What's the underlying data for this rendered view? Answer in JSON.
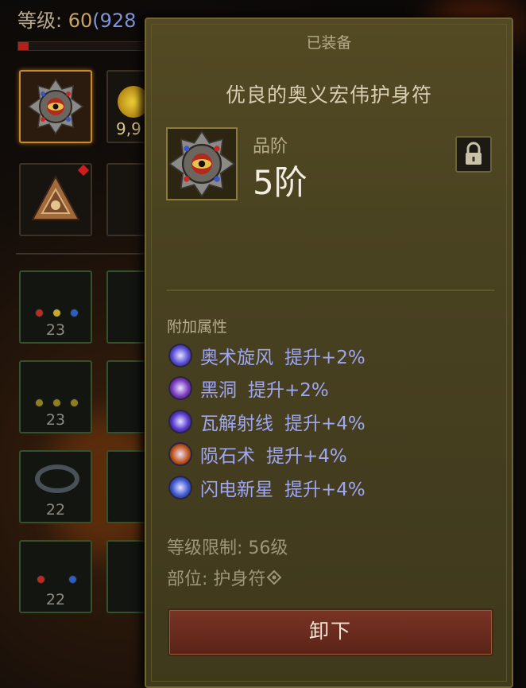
{
  "hud": {
    "level_prefix": "等级: ",
    "level": "60",
    "paragon": "(928",
    "xp_fraction": 0.08
  },
  "inventory": {
    "currency_amount": "9,9",
    "slot_counts": [
      "23",
      "23",
      "22",
      "22"
    ]
  },
  "tooltip": {
    "status": "已装备",
    "item_name": "优良的奥义宏伟护身符",
    "rank_label": "品阶",
    "rank_value": "5阶",
    "lock_icon": "padlock-icon",
    "attributes_title": "附加属性",
    "attributes": [
      {
        "name": "奥术旋风",
        "bonus": "提升+2%",
        "icon": "arcane-whirlwind-icon",
        "color": "#5a4fd6"
      },
      {
        "name": "黑洞",
        "bonus": "提升+2%",
        "icon": "black-hole-icon",
        "color": "#7d3bc0"
      },
      {
        "name": "瓦解射线",
        "bonus": "提升+4%",
        "icon": "disintegrate-ray-icon",
        "color": "#5a3bd0"
      },
      {
        "name": "陨石术",
        "bonus": "提升+4%",
        "icon": "meteor-icon",
        "color": "#c6571c"
      },
      {
        "name": "闪电新星",
        "bonus": "提升+4%",
        "icon": "lightning-nova-icon",
        "color": "#3f5ad4"
      }
    ],
    "level_requirement": "等级限制: 56级",
    "slot_label": "部位: 护身符",
    "unequip_label": "卸下"
  }
}
